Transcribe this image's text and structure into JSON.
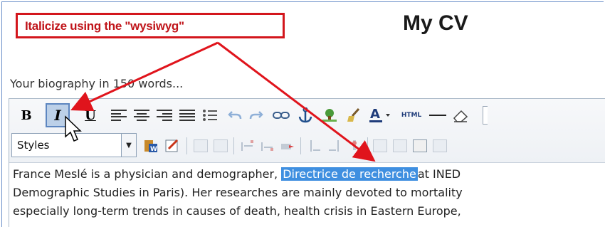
{
  "callout": {
    "text": "Italicize using the \"wysiwyg\""
  },
  "page": {
    "title": "My CV"
  },
  "bio": {
    "label": "Your biography in 150 words..."
  },
  "toolbar": {
    "bold_label": "B",
    "italic_label": "I",
    "underline_label": "U",
    "html_label": "HTML",
    "styles_select": {
      "selected": "Styles"
    }
  },
  "content": {
    "line1_before": "France Meslé is a physician and demographer,",
    "line1_highlight": "Directrice de recherche",
    "line1_after": "at INED",
    "line2": "Demographic Studies in Paris). Her researches are mainly devoted to mortality",
    "line3": "especially long-term trends in causes of death, health crisis in Eastern Europe,"
  },
  "colors": {
    "callout_red": "#d3161c",
    "highlight": "#3f8fe0",
    "active_button": "#bcd0e8",
    "frame_blue": "#6b8fc9"
  }
}
